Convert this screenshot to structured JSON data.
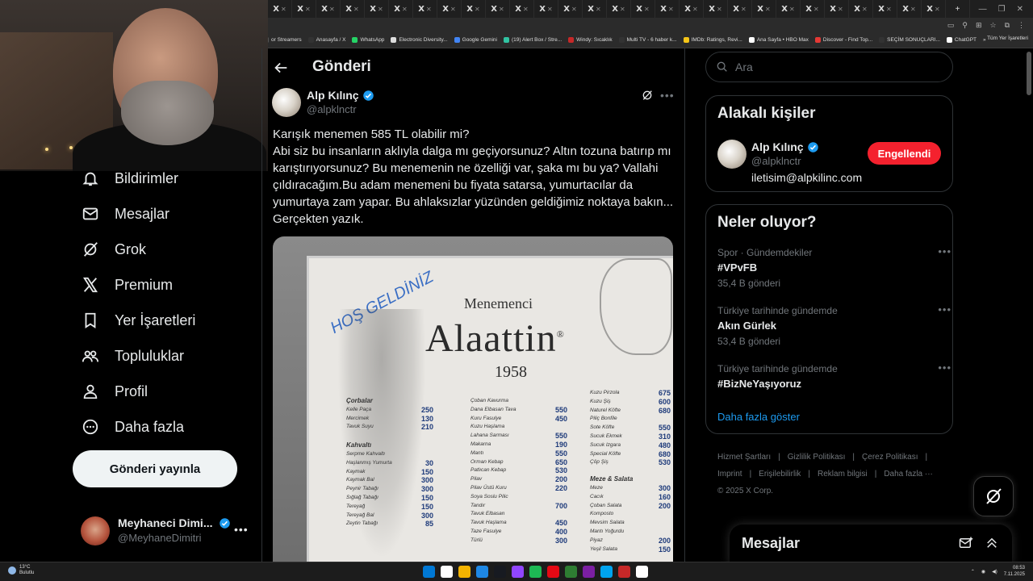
{
  "browser": {
    "tab_glyph": "X",
    "tab_close": "✕",
    "tab_count": 28,
    "bookmarks": [
      {
        "label": "or Streamers",
        "color": "#555"
      },
      {
        "label": "Anasayfa / X",
        "color": "#333"
      },
      {
        "label": "WhatsApp",
        "color": "#25d366"
      },
      {
        "label": "Electronic Diversity...",
        "color": "#ddd"
      },
      {
        "label": "Google Gemini",
        "color": "#4285f4"
      },
      {
        "label": "(19) Alert Box / Stre...",
        "color": "#31c3a2"
      },
      {
        "label": "Windy: Sıcaklık",
        "color": "#c62828"
      },
      {
        "label": "Multi TV - 6 haber k...",
        "color": "#333"
      },
      {
        "label": "IMDb: Ratings, Revi...",
        "color": "#f5c518"
      },
      {
        "label": "Ana Sayfa • HBO Max",
        "color": "#fff"
      },
      {
        "label": "Discover - Find Top...",
        "color": "#e53935"
      },
      {
        "label": "SEÇİM SONUÇLARI...",
        "color": "#333"
      },
      {
        "label": "ChatGPT",
        "color": "#fff"
      }
    ],
    "bookmarks_more": "»",
    "all_bookmarks": "Tüm Yer İşaretleri"
  },
  "nav": {
    "items": [
      {
        "label": "Bildirimler",
        "icon": "bell-icon"
      },
      {
        "label": "Mesajlar",
        "icon": "mail-icon"
      },
      {
        "label": "Grok",
        "icon": "grok-icon"
      },
      {
        "label": "Premium",
        "icon": "x-logo-icon"
      },
      {
        "label": "Yer İşaretleri",
        "icon": "bookmark-icon"
      },
      {
        "label": "Topluluklar",
        "icon": "communities-icon"
      },
      {
        "label": "Profil",
        "icon": "profile-icon"
      },
      {
        "label": "Daha fazla",
        "icon": "more-circle-icon"
      }
    ],
    "post_button": "Gönderi yayınla",
    "account": {
      "name": "Meyhaneci Dimi...",
      "handle": "@MeyhaneDimitri",
      "more": "•••"
    }
  },
  "main": {
    "title": "Gönderi",
    "tweet": {
      "name": "Alp Kılınç",
      "handle": "@alpklnctr",
      "lines": [
        "Karışık menemen 585 TL olabilir mi?",
        "Abi siz bu insanların aklıyla dalga mı geçiyorsunuz? Altın tozuna batırıp mı karıştırıyorsunuz? Bu menemenin ne özelliği var, şaka mı bu ya? Vallahi çıldıracağım.Bu adam menemeni bu fiyata satarsa, yumurtacılar da yumurtaya zam yapar. Bu ahlaksızlar yüzünden geldiğimiz noktaya bakın... Gerçekten yazık."
      ],
      "more": "•••"
    },
    "photo": {
      "handwritten": "HOŞ GELDİNİZ",
      "subtitle": "Menemenci",
      "title": "Alaattin",
      "registered": "®",
      "year": "1958",
      "col1": {
        "headers": [
          "Çorbalar",
          "Kahvaltı"
        ],
        "soup": [
          [
            "Kelle Paça",
            "250"
          ],
          [
            "Mercimek",
            "130"
          ],
          [
            "Tavuk Suyu",
            "210"
          ]
        ],
        "breakfast": [
          [
            "Serpme Kahvaltı",
            ""
          ],
          [
            "Haşlanmış Yumurta",
            "30"
          ],
          [
            "Kaymak",
            "150"
          ],
          [
            "Kaymak Bal",
            "300"
          ],
          [
            "Peynir Tabağı",
            "300"
          ],
          [
            "Sığlağ Tabağı",
            "150"
          ],
          [
            "Tereyağ",
            "150"
          ],
          [
            "Tereyağ Bal",
            "300"
          ],
          [
            "Zeytin Tabağı",
            "85"
          ]
        ]
      },
      "col2": {
        "items": [
          [
            "Çoban Kavurma",
            ""
          ],
          [
            "Dana Elbasan Tava",
            "550"
          ],
          [
            "Kuru Fasulye",
            "450"
          ],
          [
            "Kuzu Haşlama",
            ""
          ],
          [
            "Lahana Sarması",
            "550"
          ],
          [
            "Makarna",
            "190"
          ],
          [
            "Mantı",
            "550"
          ],
          [
            "Orman Kebap",
            "650"
          ],
          [
            "Patlıcan Kebap",
            "530"
          ],
          [
            "Pilav",
            "200"
          ],
          [
            "Pilav Üstü Kuru",
            "220"
          ],
          [
            "Soya Soslu Pilic",
            ""
          ],
          [
            "Tandır",
            "700"
          ],
          [
            "Tavuk Elbasan",
            ""
          ],
          [
            "Tavuk Haşlama",
            "450"
          ],
          [
            "Taze Fasulye",
            "400"
          ],
          [
            "Türlü",
            "300"
          ]
        ]
      },
      "col3": {
        "items": [
          [
            "Kuzu Pirzola",
            "675"
          ],
          [
            "Kuzu Şiş",
            "600"
          ],
          [
            "Naturel Köfte",
            "680"
          ],
          [
            "Piliç Bonfile",
            ""
          ],
          [
            "Sote Köfte",
            "550"
          ],
          [
            "Sucuk Ekmek",
            "310"
          ],
          [
            "Sucuk Izgara",
            "480"
          ],
          [
            "Special Köfte",
            "680"
          ],
          [
            "Çöp Şiş",
            "530"
          ]
        ],
        "header": "Meze & Salata",
        "meze": [
          [
            "Meze",
            "300"
          ],
          [
            "Cacık",
            "160"
          ],
          [
            "Çoban Salata",
            "200"
          ],
          [
            "Komposto",
            ""
          ],
          [
            "Mevsim Salata",
            ""
          ],
          [
            "Mantı Yoğurdu",
            ""
          ],
          [
            "Piyaz",
            "200"
          ],
          [
            "Yeşil Salata",
            "150"
          ]
        ]
      }
    }
  },
  "right": {
    "search_placeholder": "Ara",
    "related": {
      "title": "Alakalı kişiler",
      "name": "Alp Kılınç",
      "handle": "@alpklnctr",
      "bio": "iletisim@alpkilinc.com",
      "button": "Engellendi"
    },
    "trends": {
      "title": "Neler oluyor?",
      "items": [
        {
          "context": "Spor · Gündemdekiler",
          "name": "#VPvFB",
          "count": "35,4 B gönderi"
        },
        {
          "context": "Türkiye tarihinde gündemde",
          "name": "Akın Gürlek",
          "count": "53,4 B gönderi"
        },
        {
          "context": "Türkiye tarihinde gündemde",
          "name": "#BizNeYaşıyoruz",
          "count": ""
        }
      ],
      "more_glyph": "•••",
      "show_more": "Daha fazla göster"
    },
    "footer": {
      "links": [
        "Hizmet Şartları",
        "Gizlilik Politikası",
        "Çerez Politikası",
        "Imprint",
        "Erişilebilirlik",
        "Reklam bilgisi",
        "Daha fazla ···"
      ],
      "separator": "|",
      "copyright": "© 2025 X Corp."
    },
    "messages": {
      "title": "Mesajlar"
    }
  },
  "taskbar": {
    "temp": "13°C",
    "condition": "Bulutlu",
    "time": "08:53",
    "date": "7.11.2025",
    "apps": [
      "#0078d4",
      "#ffffff",
      "#f4b400",
      "#1e88e5",
      "#171a21",
      "#9146ff",
      "#1db954",
      "#e50914",
      "#2e7d32",
      "#7b1fa2",
      "#00a4ef",
      "#c62828",
      "#ffffff"
    ]
  },
  "colors": {
    "accent": "#1d9bf0",
    "danger": "#f4212e",
    "text": "#e7e9ea",
    "muted": "#71767b",
    "border": "#2f3336"
  }
}
